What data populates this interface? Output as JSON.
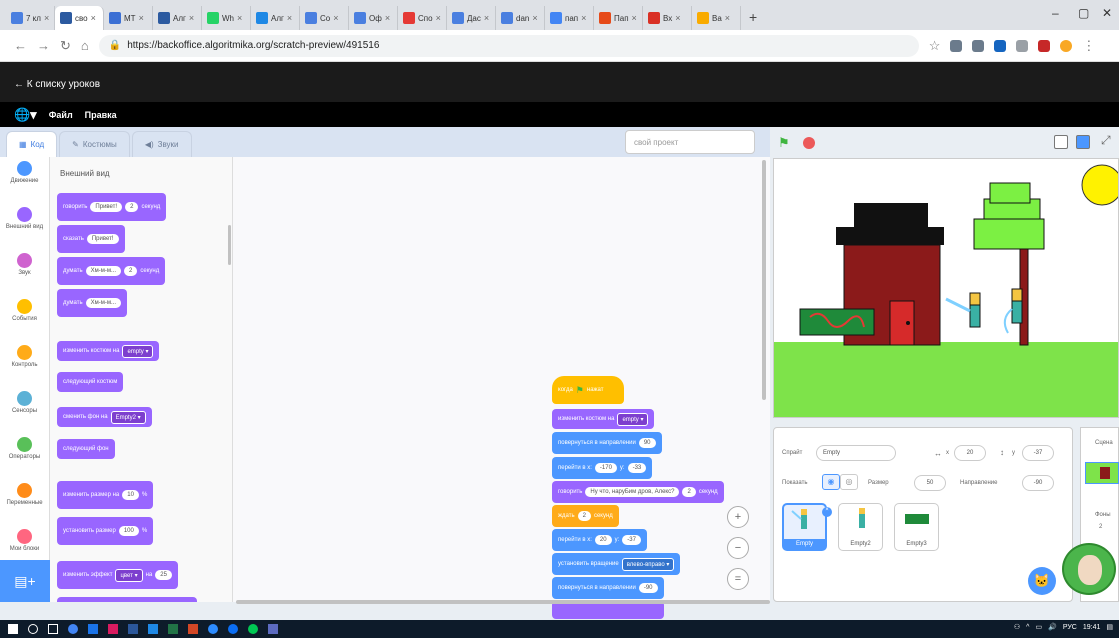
{
  "browser": {
    "tabs": [
      {
        "label": "7 кл",
        "color": "#4a7fe0"
      },
      {
        "label": "сво",
        "color": "#2c5aa0",
        "active": true
      },
      {
        "label": "MT",
        "color": "#3b6fd4"
      },
      {
        "label": "Алг",
        "color": "#2c5aa0"
      },
      {
        "label": "Wh",
        "color": "#25d366"
      },
      {
        "label": "Алг",
        "color": "#1e88e5"
      },
      {
        "label": "Co",
        "color": "#4a7fe0"
      },
      {
        "label": "Оф",
        "color": "#4a7fe0"
      },
      {
        "label": "Спо",
        "color": "#e53935"
      },
      {
        "label": "Дас",
        "color": "#4a7fe0"
      },
      {
        "label": "dan",
        "color": "#4a7fe0"
      },
      {
        "label": "пап",
        "color": "#4285f4"
      },
      {
        "label": "Пап",
        "color": "#e64a19"
      },
      {
        "label": "Вх",
        "color": "#d93025"
      },
      {
        "label": "Ва",
        "color": "#f9ab00"
      }
    ],
    "url": "https://backoffice.algoritmika.org/scratch-preview/491516"
  },
  "app": {
    "back_link": "← К списку уроков",
    "menu_file": "Файл",
    "menu_edit": "Правка",
    "tabs": {
      "code": "Код",
      "costumes": "Костюмы",
      "sounds": "Звуки"
    },
    "project_name": "свой проект"
  },
  "categories": [
    {
      "label": "Движение",
      "color": "#4c97ff"
    },
    {
      "label": "Внешний вид",
      "color": "#9966ff"
    },
    {
      "label": "Звук",
      "color": "#cf63cf"
    },
    {
      "label": "События",
      "color": "#ffbf00"
    },
    {
      "label": "Контроль",
      "color": "#ffab19"
    },
    {
      "label": "Сенсоры",
      "color": "#5cb1d6"
    },
    {
      "label": "Операторы",
      "color": "#59c059"
    },
    {
      "label": "Переменные",
      "color": "#ff8c1a"
    },
    {
      "label": "Мои блоки",
      "color": "#ff6680"
    }
  ],
  "palette": {
    "title": "Внешний вид",
    "say_secs": {
      "pre": "говорить",
      "text": "Привет!",
      "num": "2",
      "post": "секунд"
    },
    "say": {
      "pre": "сказать",
      "text": "Привет!"
    },
    "think_secs": {
      "pre": "думать",
      "text": "Хм-м-м...",
      "num": "2",
      "post": "секунд"
    },
    "think": {
      "pre": "думать",
      "text": "Хм-м-м..."
    },
    "switch_costume": {
      "pre": "изменить костюм на",
      "value": "empty ▾"
    },
    "next_costume": "следующий костюм",
    "switch_backdrop": {
      "pre": "сменить фон на",
      "value": "Empty2 ▾"
    },
    "next_backdrop": "следующий фон",
    "change_size": {
      "pre": "изменить размер на",
      "num": "10",
      "post": "%"
    },
    "set_size": {
      "pre": "установить размер",
      "num": "100",
      "post": "%"
    },
    "change_effect": {
      "pre": "изменить эффект",
      "value": "цвет ▾",
      "mid": "на",
      "num": "25"
    }
  },
  "script": {
    "hat": {
      "pre": "когда",
      "flag": "⚑",
      "post": "нажат"
    },
    "costume": {
      "pre": "изменить костюм на",
      "value": "empty ▾"
    },
    "point": {
      "pre": "повернуться в направлении",
      "num": "90"
    },
    "goto1": {
      "pre": "перейти в x:",
      "x": "-170",
      "ymid": "y:",
      "y": "-33"
    },
    "say": {
      "pre": "говорить",
      "text": "Ну что, наруБим дров, Алекс?",
      "num": "2",
      "post": "секунд"
    },
    "wait": {
      "pre": "ждать",
      "num": "2",
      "post": "секунд"
    },
    "goto2": {
      "pre": "перейти в x:",
      "x": "20",
      "ymid": "y:",
      "y": "-37"
    },
    "rotation": {
      "pre": "установить вращение",
      "value": "влево-вправо ▾"
    },
    "point2": {
      "pre": "повернуться в направлении",
      "num": "-90"
    }
  },
  "zoom": {
    "in": "+",
    "out": "−",
    "reset": "="
  },
  "sprite_info": {
    "label_sprite": "Спрайт",
    "name": "Empty",
    "x_label": "x",
    "x": "20",
    "y_label": "y",
    "y": "-37",
    "show_label": "Показать",
    "size_label": "Размер",
    "size": "50",
    "direction_label": "Направление",
    "direction": "-90"
  },
  "sprites": [
    {
      "name": "Empty",
      "selected": true
    },
    {
      "name": "Empty2"
    },
    {
      "name": "Empty3"
    }
  ],
  "scene": {
    "label": "Сцена",
    "backdrops_label": "Фоны",
    "backdrops_count": "2"
  },
  "taskbar": {
    "lang": "РУС",
    "time": "19:41"
  }
}
